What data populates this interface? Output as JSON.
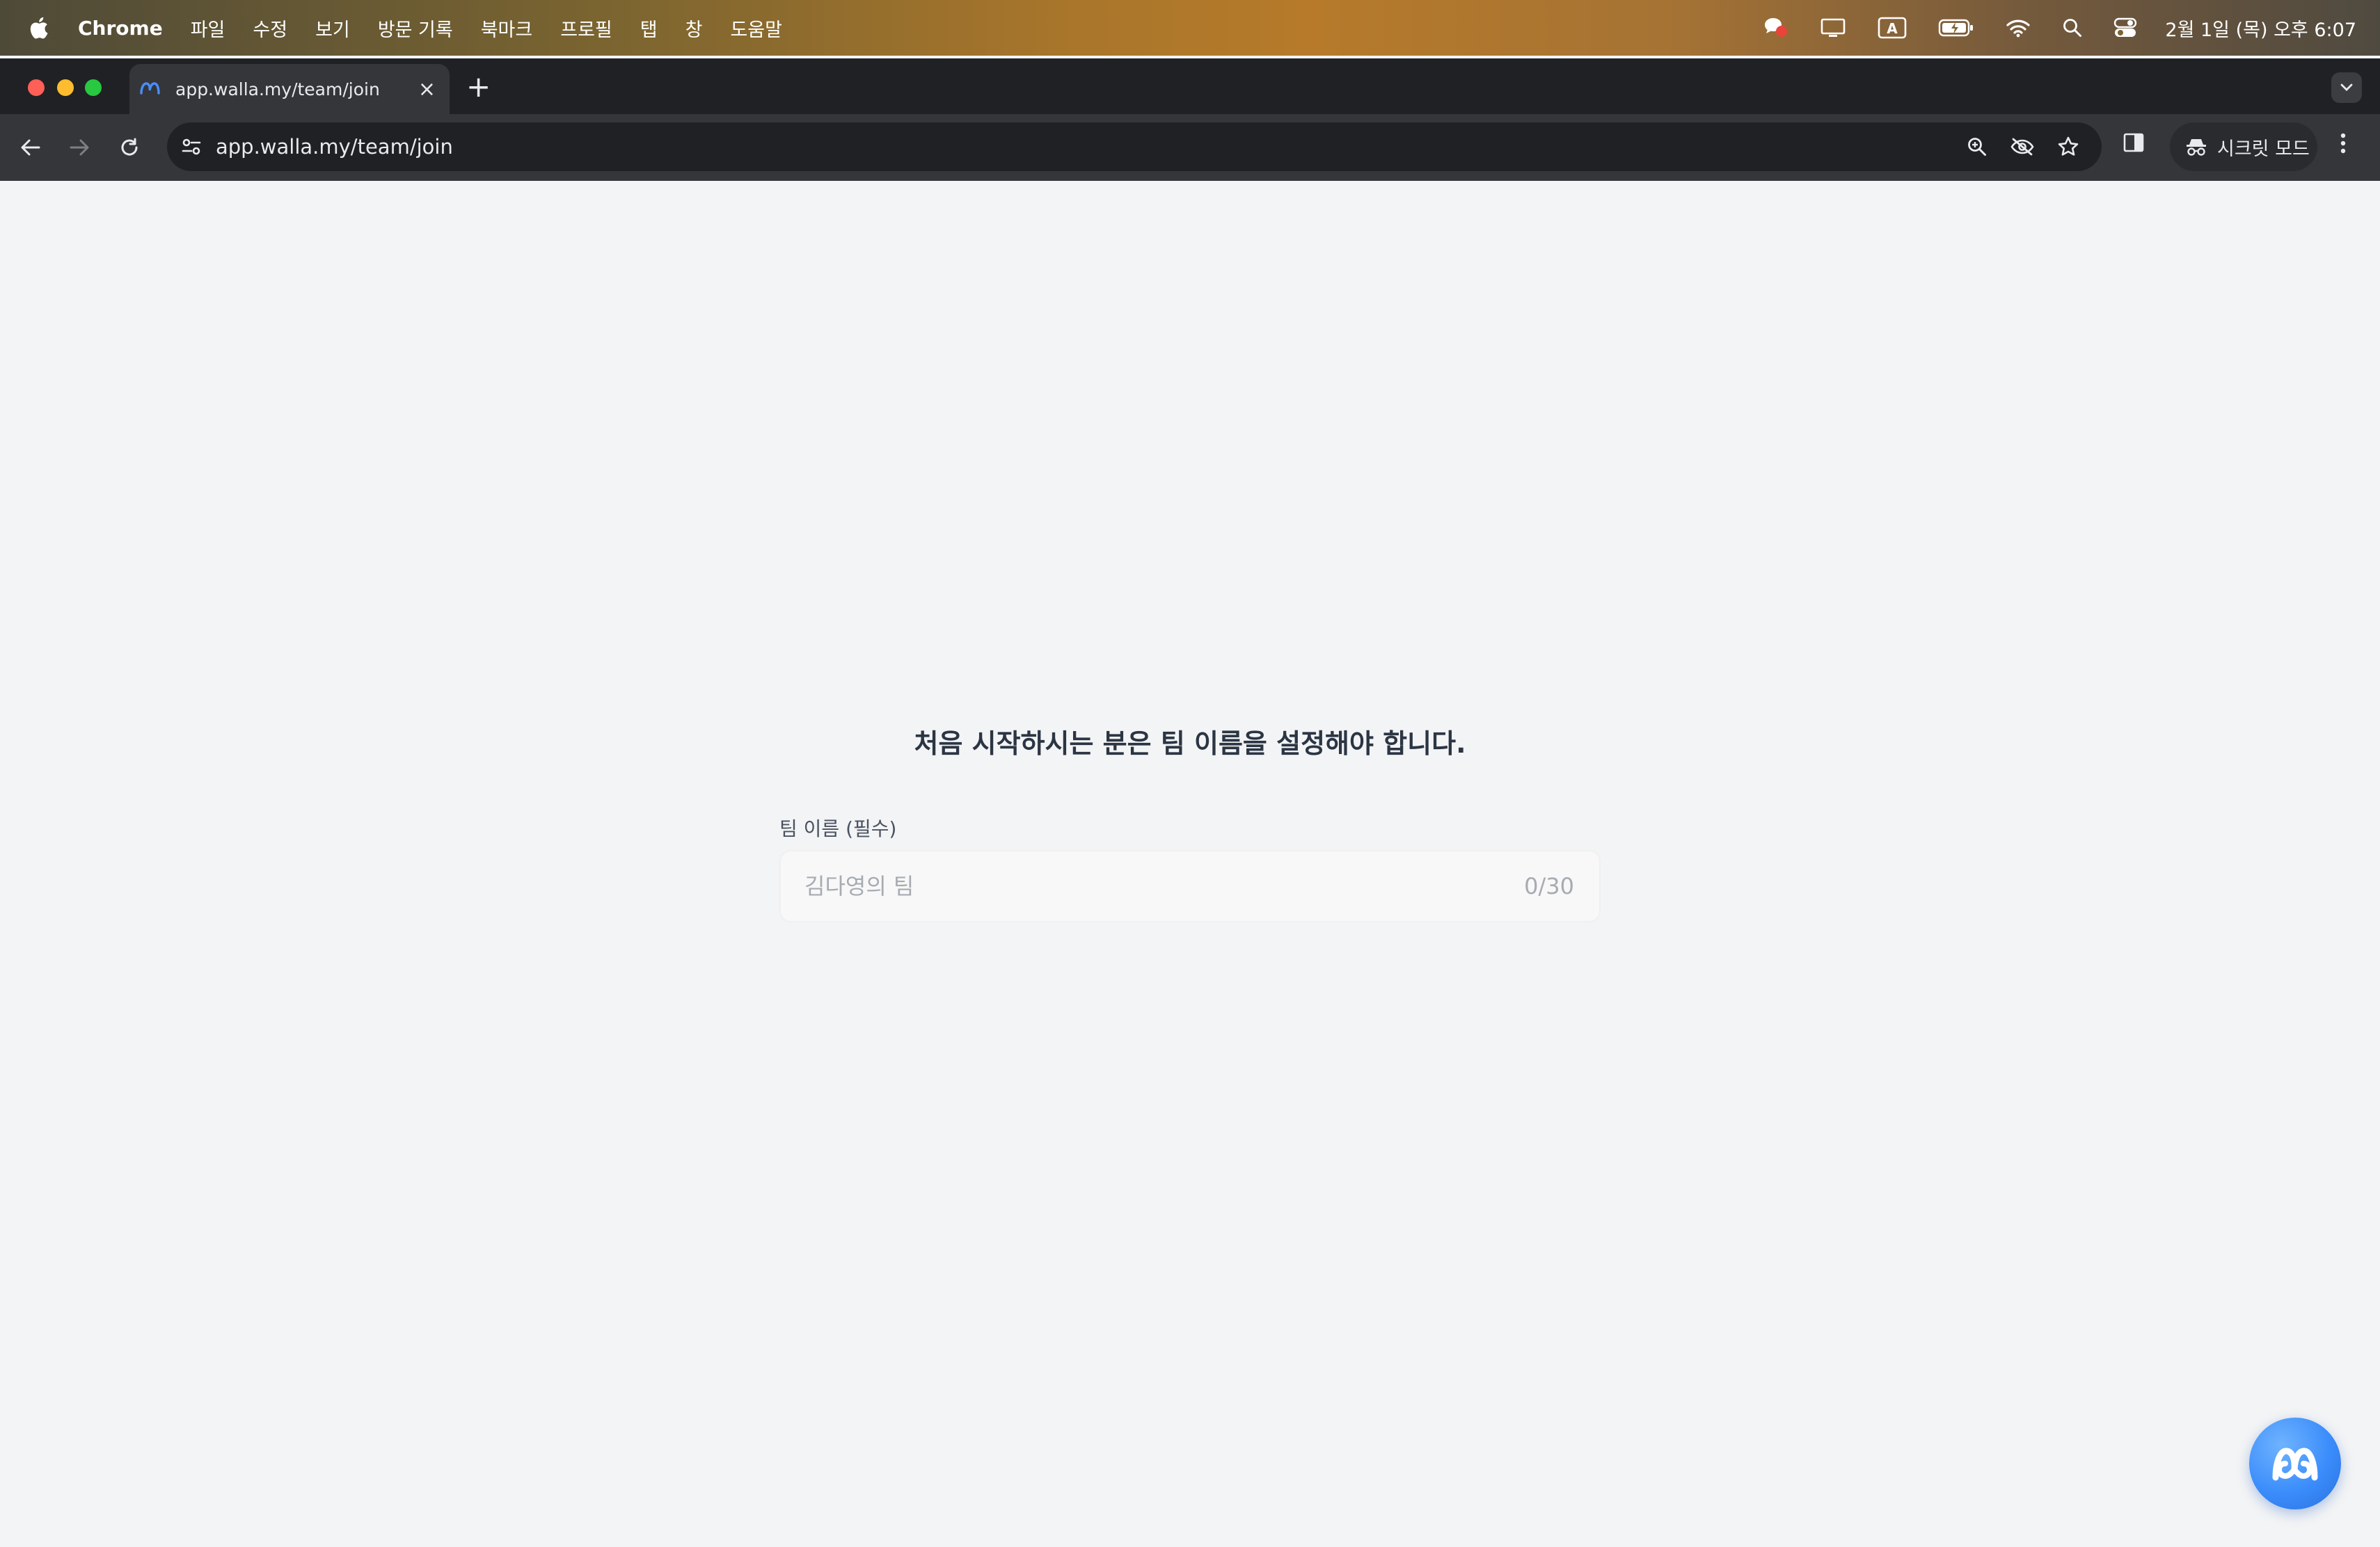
{
  "menubar": {
    "app_name": "Chrome",
    "menus": [
      "파일",
      "수정",
      "보기",
      "방문 기록",
      "북마크",
      "프로필",
      "탭",
      "창",
      "도움말"
    ],
    "clock": "2월 1일 (목) 오후 6:07",
    "status_icons": [
      "chat-notification-icon",
      "display-icon",
      "input-source-icon",
      "battery-icon",
      "wifi-icon",
      "spotlight-icon",
      "control-center-icon"
    ],
    "input_source_label": "A"
  },
  "browser": {
    "tab_title": "app.walla.my/team/join",
    "tab_close": "×",
    "new_tab": "+",
    "url": "app.walla.my/team/join",
    "incognito_label": "시크릿 모드"
  },
  "page": {
    "heading": "처음 시작하시는 분은 팀 이름을 설정해야 합니다.",
    "field_label": "팀 이름 (필수)",
    "field_placeholder": "김다영의 팀",
    "field_value": "",
    "counter": "0/30"
  },
  "colors": {
    "page_bg": "#f3f4f5",
    "fab_accent": "#3b8dfb",
    "heading": "#2b3544"
  }
}
